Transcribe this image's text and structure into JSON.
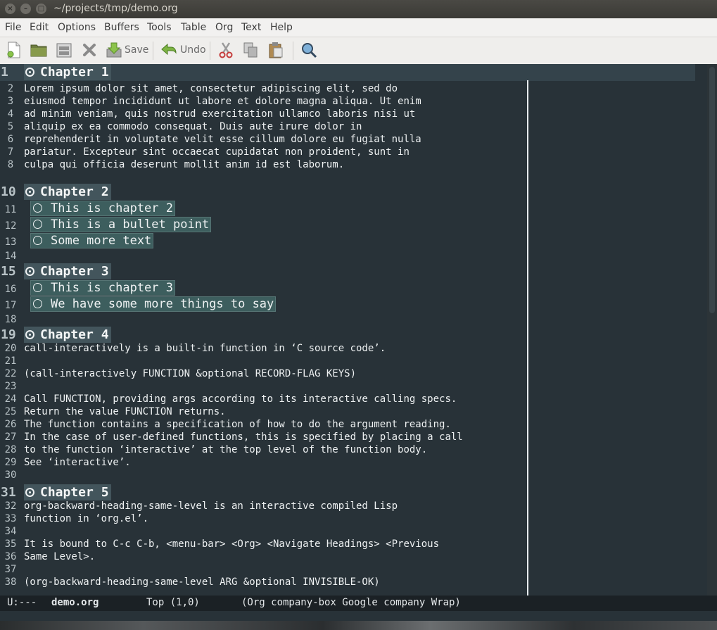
{
  "window": {
    "title": "~/projects/tmp/demo.org"
  },
  "menu": [
    "File",
    "Edit",
    "Options",
    "Buffers",
    "Tools",
    "Table",
    "Org",
    "Text",
    "Help"
  ],
  "toolbar": {
    "save_label": "Save",
    "undo_label": "Undo"
  },
  "editor": {
    "lines": [
      {
        "n": "1",
        "kind": "heading",
        "text": "Chapter 1"
      },
      {
        "n": "2",
        "kind": "text",
        "text": "Lorem ipsum dolor sit amet, consectetur adipiscing elit, sed do"
      },
      {
        "n": "3",
        "kind": "text",
        "text": "eiusmod tempor incididunt ut labore et dolore magna aliqua. Ut enim"
      },
      {
        "n": "4",
        "kind": "text",
        "text": "ad minim veniam, quis nostrud exercitation ullamco laboris nisi ut"
      },
      {
        "n": "5",
        "kind": "text",
        "text": "aliquip ex ea commodo consequat. Duis aute irure dolor in"
      },
      {
        "n": "6",
        "kind": "text",
        "text": "reprehenderit in voluptate velit esse cillum dolore eu fugiat nulla"
      },
      {
        "n": "7",
        "kind": "text",
        "text": "pariatur. Excepteur sint occaecat cupidatat non proident, sunt in"
      },
      {
        "n": "8",
        "kind": "text",
        "text": "culpa qui officia deserunt mollit anim id est laborum."
      },
      {
        "n": "10",
        "kind": "heading",
        "text": "Chapter 2"
      },
      {
        "n": "11",
        "kind": "bullet",
        "text": "This is chapter 2"
      },
      {
        "n": "12",
        "kind": "bullet",
        "text": "This is a bullet point"
      },
      {
        "n": "13",
        "kind": "bullet",
        "text": "Some more text"
      },
      {
        "n": "14",
        "kind": "text",
        "text": ""
      },
      {
        "n": "15",
        "kind": "heading",
        "text": "Chapter 3"
      },
      {
        "n": "16",
        "kind": "bullet",
        "text": "This is chapter 3"
      },
      {
        "n": "17",
        "kind": "bullet",
        "text": "We have some more things to say"
      },
      {
        "n": "18",
        "kind": "text",
        "text": ""
      },
      {
        "n": "19",
        "kind": "heading",
        "text": "Chapter 4"
      },
      {
        "n": "20",
        "kind": "text",
        "text": "call-interactively is a built-in function in ‘C source code’."
      },
      {
        "n": "21",
        "kind": "text",
        "text": ""
      },
      {
        "n": "22",
        "kind": "text",
        "text": "(call-interactively FUNCTION &optional RECORD-FLAG KEYS)"
      },
      {
        "n": "23",
        "kind": "text",
        "text": ""
      },
      {
        "n": "24",
        "kind": "text",
        "text": "Call FUNCTION, providing args according to its interactive calling specs."
      },
      {
        "n": "25",
        "kind": "text",
        "text": "Return the value FUNCTION returns."
      },
      {
        "n": "26",
        "kind": "text",
        "text": "The function contains a specification of how to do the argument reading."
      },
      {
        "n": "27",
        "kind": "text",
        "text": "In the case of user-defined functions, this is specified by placing a call"
      },
      {
        "n": "28",
        "kind": "text",
        "text": "to the function ‘interactive’ at the top level of the function body."
      },
      {
        "n": "29",
        "kind": "text",
        "text": "See ‘interactive’."
      },
      {
        "n": "30",
        "kind": "text",
        "text": ""
      },
      {
        "n": "31",
        "kind": "heading",
        "text": "Chapter 5"
      },
      {
        "n": "32",
        "kind": "text",
        "text": "org-backward-heading-same-level is an interactive compiled Lisp"
      },
      {
        "n": "33",
        "kind": "text",
        "text": "function in ‘org.el’."
      },
      {
        "n": "34",
        "kind": "text",
        "text": ""
      },
      {
        "n": "35",
        "kind": "text",
        "text": "It is bound to C-c C-b, <menu-bar> <Org> <Navigate Headings> <Previous"
      },
      {
        "n": "36",
        "kind": "text",
        "text": "Same Level>."
      },
      {
        "n": "37",
        "kind": "text",
        "text": ""
      },
      {
        "n": "38",
        "kind": "text",
        "text": "(org-backward-heading-same-level ARG &optional INVISIBLE-OK)"
      }
    ]
  },
  "modeline": {
    "status": "U:---",
    "buffer": "demo.org",
    "position": "Top (1,0)",
    "modes": "(Org company-box Google company Wrap)"
  },
  "colors": {
    "editor_bg": "#283238",
    "heading_bg": "#43555c",
    "bullet_bg": "#3d5e5e",
    "text": "#eef1f2"
  }
}
